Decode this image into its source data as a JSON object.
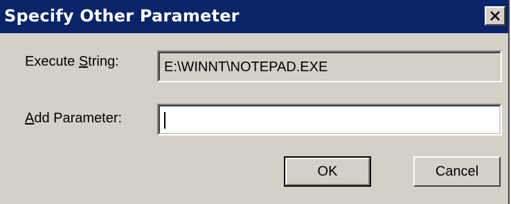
{
  "dialog": {
    "title": "Specify Other Parameter",
    "close_icon": "close-x-icon"
  },
  "execute_string": {
    "label_prefix": "Execute ",
    "label_accel": "S",
    "label_suffix": "tring:",
    "value": "E:\\WINNT\\NOTEPAD.EXE"
  },
  "add_parameter": {
    "label_accel": "A",
    "label_suffix": "dd Parameter:",
    "value": ""
  },
  "buttons": {
    "ok_label": "OK",
    "cancel_label": "Cancel"
  },
  "colors": {
    "titlebar": "#0a246a",
    "face": "#d4d0c8"
  }
}
